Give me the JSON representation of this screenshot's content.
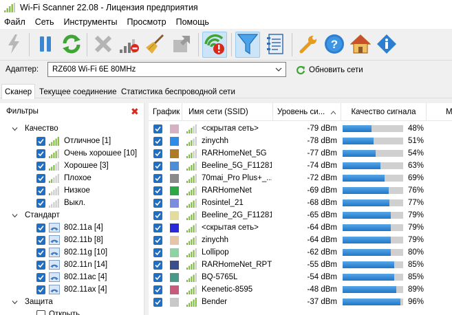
{
  "window": {
    "title": "Wi-Fi Scanner 22.08 - Лицензия предприятия",
    "app_icon": "wifi-app-icon"
  },
  "menu": {
    "items": [
      "Файл",
      "Сеть",
      "Инструменты",
      "Просмотр",
      "Помощь"
    ]
  },
  "toolbar": {
    "buttons": [
      {
        "icon": "bolt-icon",
        "state": "disabled"
      },
      {
        "icon": "pause-icon",
        "state": "normal"
      },
      {
        "icon": "refresh-arrows-icon",
        "state": "normal"
      },
      {
        "icon": "clear-x-icon",
        "state": "disabled"
      },
      {
        "icon": "signal-delete-icon",
        "state": "normal"
      },
      {
        "icon": "broom-icon",
        "state": "normal"
      },
      {
        "icon": "export-icon",
        "state": "disabled"
      },
      {
        "icon": "wifi-alert-icon",
        "state": "active"
      },
      {
        "icon": "filter-funnel-icon",
        "state": "active"
      },
      {
        "icon": "notebook-icon",
        "state": "normal"
      },
      {
        "icon": "wrench-icon",
        "state": "normal"
      },
      {
        "icon": "help-icon",
        "state": "normal"
      },
      {
        "icon": "home-icon",
        "state": "normal"
      },
      {
        "icon": "info-icon",
        "state": "normal"
      }
    ]
  },
  "adapter": {
    "label": "Адаптер:",
    "value": "RZ608 Wi-Fi 6E 80MHz",
    "refresh_label": "Обновить сети"
  },
  "tabs": [
    {
      "label": "Сканер",
      "active": true
    },
    {
      "label": "Текущее соединение",
      "active": false
    },
    {
      "label": "Статистика беспроводной сети",
      "active": false
    }
  ],
  "filters": {
    "title": "Фильтры",
    "groups": [
      {
        "label": "Качество",
        "items": [
          {
            "label": "Отличное [1]",
            "icon": "signal-excellent-icon",
            "bars": 5,
            "checked": true
          },
          {
            "label": "Очень хорошее [10]",
            "icon": "signal-verygood-icon",
            "bars": 4,
            "checked": true
          },
          {
            "label": "Хорошее [3]",
            "icon": "signal-good-icon",
            "bars": 3,
            "checked": true
          },
          {
            "label": "Плохое",
            "icon": "signal-poor-icon",
            "bars": 2,
            "checked": true
          },
          {
            "label": "Низкое",
            "icon": "signal-low-icon",
            "bars": 1,
            "checked": true
          },
          {
            "label": "Выкл.",
            "icon": "signal-off-icon",
            "bars": 0,
            "checked": true
          }
        ]
      },
      {
        "label": "Стандарт",
        "items": [
          {
            "label": "802.11a [4]",
            "icon": "wifi-standard-icon",
            "checked": true
          },
          {
            "label": "802.11b [8]",
            "icon": "wifi-standard-icon",
            "checked": true
          },
          {
            "label": "802.11g [10]",
            "icon": "wifi-standard-icon",
            "checked": true
          },
          {
            "label": "802.11n [14]",
            "icon": "wifi-standard-icon",
            "checked": true
          },
          {
            "label": "802.11ac [4]",
            "icon": "wifi-standard-icon",
            "checked": true
          },
          {
            "label": "802.11ax [4]",
            "icon": "wifi-standard-icon",
            "checked": true
          }
        ]
      },
      {
        "label": "Защита",
        "items": [
          {
            "label": "Открыть",
            "icon": "",
            "checked": false
          }
        ]
      }
    ]
  },
  "grid": {
    "columns": [
      "График",
      "Имя сети (SSID)",
      "Уровень си...",
      "Качество сигнала",
      "М"
    ],
    "rows": [
      {
        "color": "#d8b0c4",
        "ssid": "<скрытая сеть>",
        "level": "-79 dBm",
        "quality": 48,
        "quality_text": "48%",
        "bars": 3
      },
      {
        "color": "#2f8ce6",
        "ssid": "zinychh",
        "level": "-78 dBm",
        "quality": 51,
        "quality_text": "51%",
        "bars": 3
      },
      {
        "color": "#b07b26",
        "ssid": "RARHomeNet_5G",
        "level": "-77 dBm",
        "quality": 54,
        "quality_text": "54%",
        "bars": 3
      },
      {
        "color": "#4a8fd8",
        "ssid": "Beeline_5G_F11281",
        "level": "-74 dBm",
        "quality": 63,
        "quality_text": "63%",
        "bars": 4
      },
      {
        "color": "#8a8a8a",
        "ssid": "70mai_Pro Plus+_...",
        "level": "-72 dBm",
        "quality": 69,
        "quality_text": "69%",
        "bars": 4
      },
      {
        "color": "#2ea844",
        "ssid": "RARHomeNet",
        "level": "-69 dBm",
        "quality": 76,
        "quality_text": "76%",
        "bars": 4
      },
      {
        "color": "#7b8de0",
        "ssid": "Rosintel_21",
        "level": "-68 dBm",
        "quality": 77,
        "quality_text": "77%",
        "bars": 4
      },
      {
        "color": "#e3dc9c",
        "ssid": "Beeline_2G_F11281",
        "level": "-65 dBm",
        "quality": 79,
        "quality_text": "79%",
        "bars": 4
      },
      {
        "color": "#2a2ad8",
        "ssid": "<скрытая сеть>",
        "level": "-64 dBm",
        "quality": 79,
        "quality_text": "79%",
        "bars": 4
      },
      {
        "color": "#e6c4a8",
        "ssid": "zinychh",
        "level": "-64 dBm",
        "quality": 79,
        "quality_text": "79%",
        "bars": 4
      },
      {
        "color": "#8dd3a4",
        "ssid": "Lollipop",
        "level": "-62 dBm",
        "quality": 80,
        "quality_text": "80%",
        "bars": 4
      },
      {
        "color": "#3c4c8c",
        "ssid": "RARHomeNet_RPT",
        "level": "-55 dBm",
        "quality": 85,
        "quality_text": "85%",
        "bars": 4
      },
      {
        "color": "#4a9a8a",
        "ssid": "BQ-5765L",
        "level": "-54 dBm",
        "quality": 85,
        "quality_text": "85%",
        "bars": 4
      },
      {
        "color": "#c85a7c",
        "ssid": "Keenetic-8595",
        "level": "-48 dBm",
        "quality": 89,
        "quality_text": "89%",
        "bars": 4
      },
      {
        "color": "#c8c8c8",
        "ssid": "Bender",
        "level": "-37 dBm",
        "quality": 96,
        "quality_text": "96%",
        "bars": 5
      }
    ]
  }
}
